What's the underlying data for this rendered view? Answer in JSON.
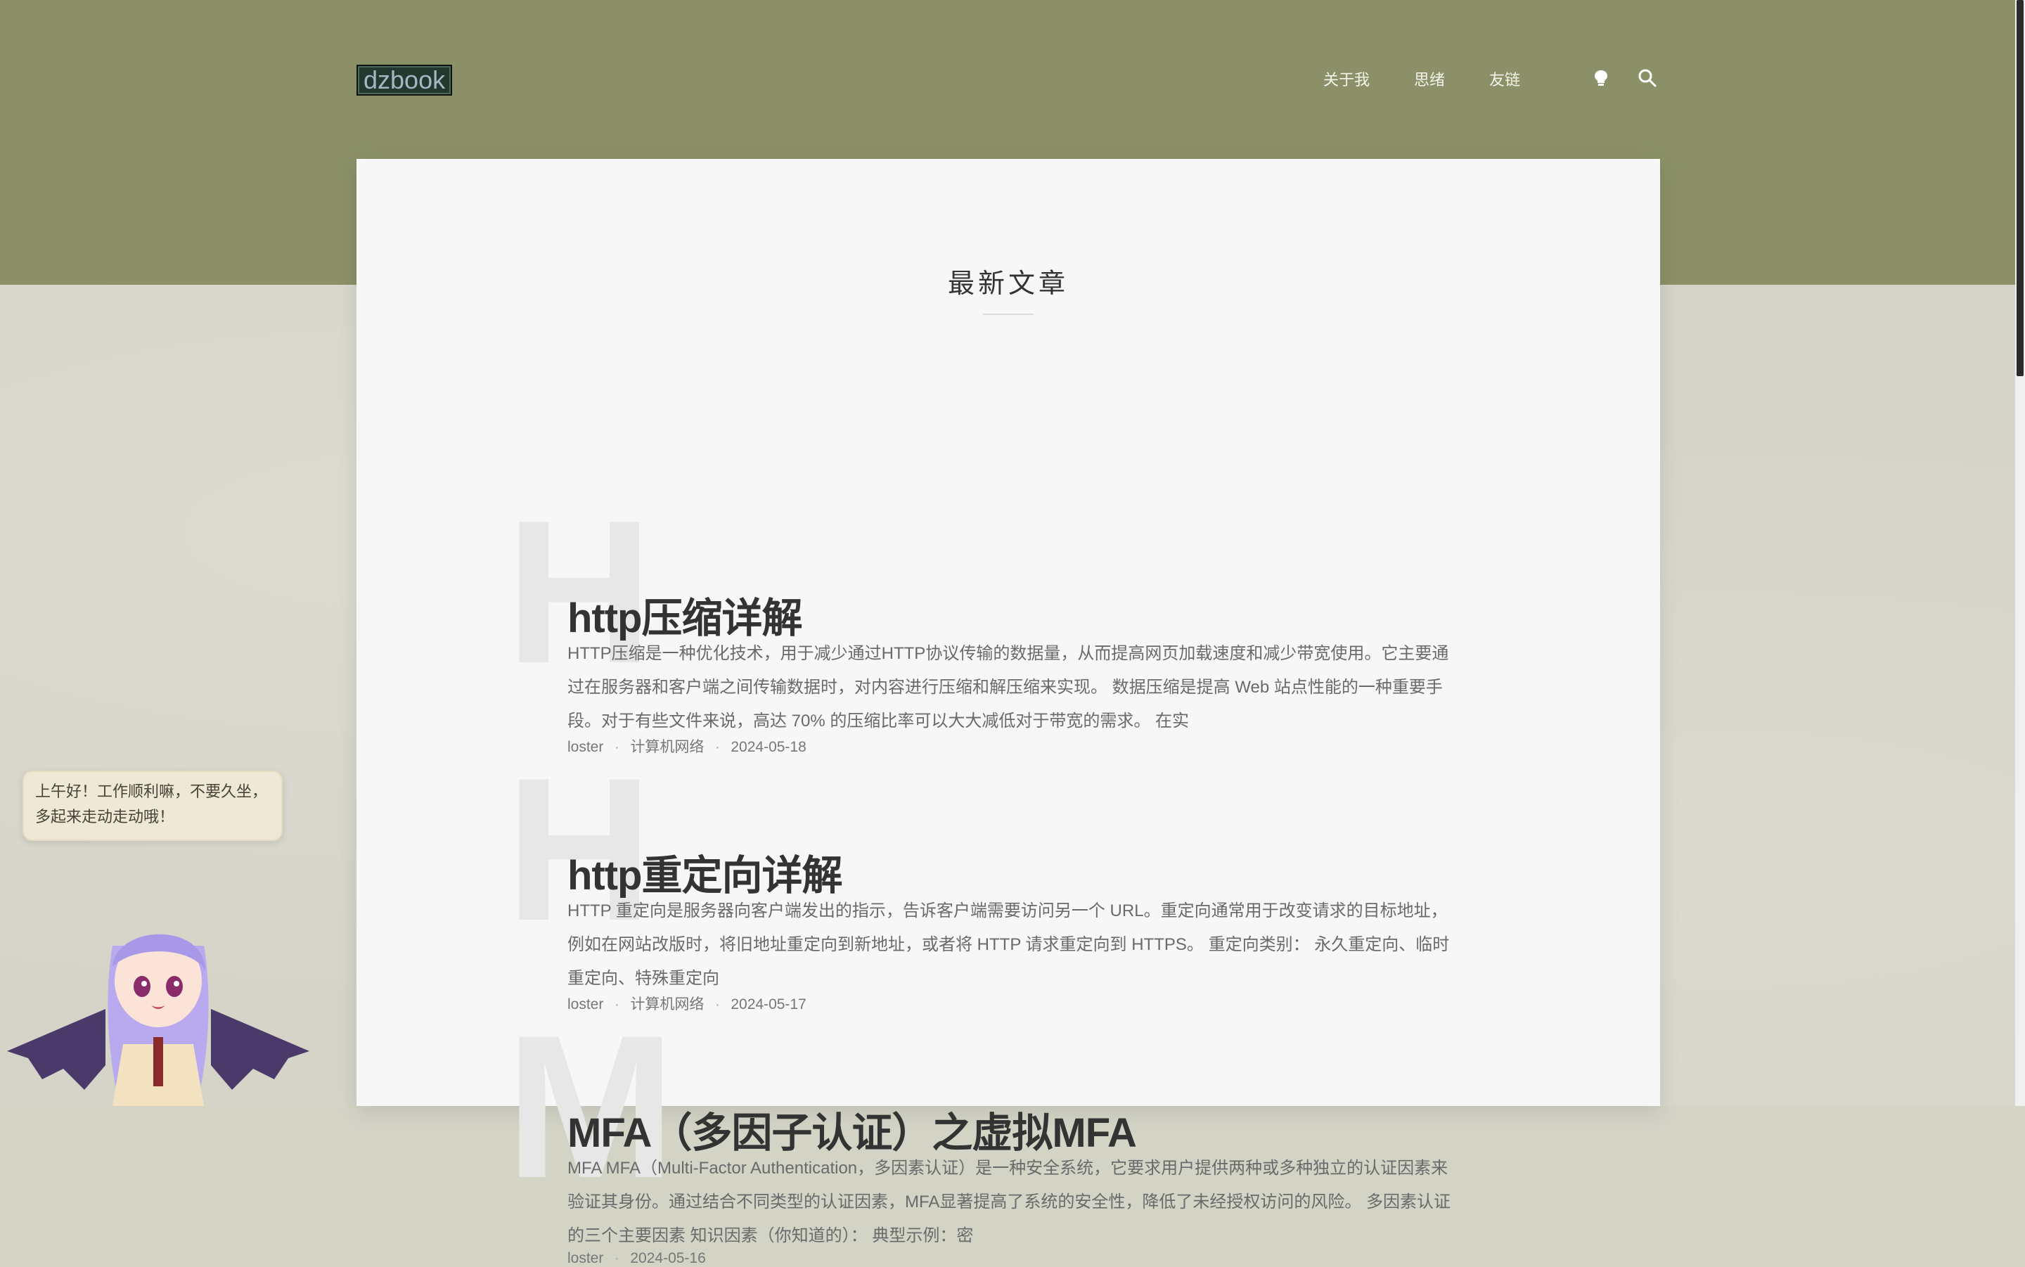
{
  "site": {
    "logo": "dzbook"
  },
  "nav": {
    "items": [
      {
        "label": "关于我"
      },
      {
        "label": "思绪"
      },
      {
        "label": "友链"
      }
    ],
    "icons": [
      "lightbulb-icon",
      "search-icon"
    ]
  },
  "main": {
    "section_title": "最新文章",
    "articles": [
      {
        "letter": "H",
        "title": "http压缩详解",
        "excerpt": "HTTP压缩是一种优化技术，用于减少通过HTTP协议传输的数据量，从而提高网页加载速度和减少带宽使用。它主要通过在服务器和客户端之间传输数据时，对内容进行压缩和解压缩来实现。 数据压缩是提高 Web 站点性能的一种重要手段。对于有些文件来说，高达 70% 的压缩比率可以大大减低对于带宽的需求。 在实",
        "author": "loster",
        "category": "计算机网络",
        "date": "2024-05-18"
      },
      {
        "letter": "H",
        "title": "http重定向详解",
        "excerpt": "HTTP 重定向是服务器向客户端发出的指示，告诉客户端需要访问另一个 URL。重定向通常用于改变请求的目标地址，例如在网站改版时，将旧地址重定向到新地址，或者将 HTTP 请求重定向到 HTTPS。 重定向类别： 永久重定向、临时重定向、特殊重定向",
        "author": "loster",
        "category": "计算机网络",
        "date": "2024-05-17"
      },
      {
        "letter": "M",
        "title": "MFA（多因子认证）之虚拟MFA",
        "excerpt": "MFA MFA（Multi-Factor Authentication，多因素认证）是一种安全系统，它要求用户提供两种或多种独立的认证因素来验证其身份。通过结合不同类型的认证因素，MFA显著提高了系统的安全性，降低了未经授权访问的风险。 多因素认证的三个主要因素 知识因素（你知道的）： 典型示例：密",
        "author": "loster",
        "date": "2024-05-16"
      }
    ]
  },
  "widget": {
    "bubble_text": "上午好！工作顺利嘛，不要久坐，多起来走动走动哦！"
  },
  "colors": {
    "header_bg": "#8b9068",
    "page_bg": "#d4d4c8",
    "card_bg": "#f7f7f7",
    "logo_bg": "#23382f"
  }
}
